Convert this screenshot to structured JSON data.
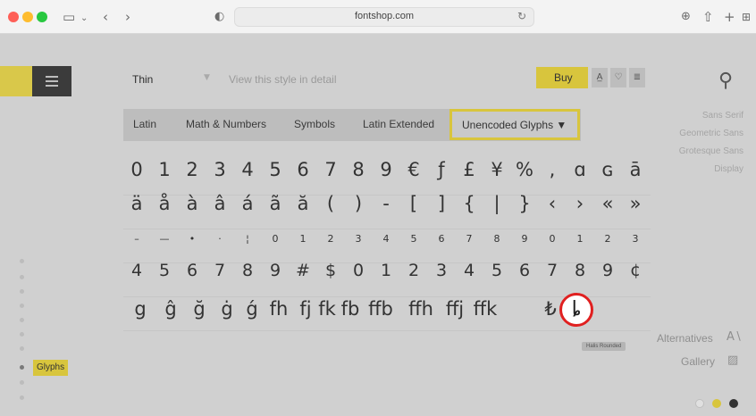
{
  "browser": {
    "url": "fontshop.com",
    "icons": [
      "sidebar-icon",
      "chevron-left-icon",
      "chevron-right-icon",
      "privacy-icon",
      "reload-icon",
      "download-icon",
      "share-icon",
      "new-tab-icon",
      "tab-overview-icon"
    ]
  },
  "toolbar": {
    "style": "Thin",
    "view_detail": "View this style in detail",
    "buy": "Buy",
    "tool_aa": "A̲",
    "tool_heart": "♡",
    "tool_list": "≣"
  },
  "tabs": {
    "latin": "Latin",
    "math": "Math & Numbers",
    "symbols": "Symbols",
    "latin_ext": "Latin Extended",
    "unencoded": "Unencoded Glyphs ▼"
  },
  "right_nav": {
    "sans_serif": "Sans Serif",
    "geometric": "Geometric Sans",
    "grotesque": "Grotesque Sans",
    "display": "Display",
    "alternatives": "Alternatives",
    "gallery": "Gallery"
  },
  "glyphs": {
    "row1": [
      "0",
      "1",
      "2",
      "3",
      "4",
      "5",
      "6",
      "7",
      "8",
      "9",
      "€",
      "ƒ",
      "£",
      "¥",
      "%",
      ",",
      "ɑ",
      "ɢ",
      "ā"
    ],
    "row2": [
      "ä",
      "å",
      "à",
      "â",
      "á",
      "ã",
      "ă",
      "(",
      ")",
      "-",
      "[",
      "]",
      "{",
      "|",
      "}",
      "‹",
      "›",
      "«",
      "»"
    ],
    "row3": [
      "–",
      "—",
      "•",
      "·",
      "¦",
      "0",
      "1",
      "2",
      "3",
      "4",
      "5",
      "6",
      "7",
      "8",
      "9",
      "0",
      "1",
      "2",
      "3"
    ],
    "row4": [
      "4",
      "5",
      "6",
      "7",
      "8",
      "9",
      "#",
      "$",
      "0",
      "1",
      "2",
      "3",
      "4",
      "5",
      "6",
      "7",
      "8",
      "9",
      "¢"
    ],
    "row5": [
      "g",
      "ĝ",
      "ğ",
      "ġ",
      "ǵ",
      "fh",
      "fj",
      "fk",
      "fb",
      "ffb",
      "ffh",
      "ffj",
      "ffk",
      "ȴ",
      "₺"
    ]
  },
  "highlight_glyph": "ȴ",
  "tooltip": "Halis Rounded",
  "sidebar_label": "Glyphs"
}
